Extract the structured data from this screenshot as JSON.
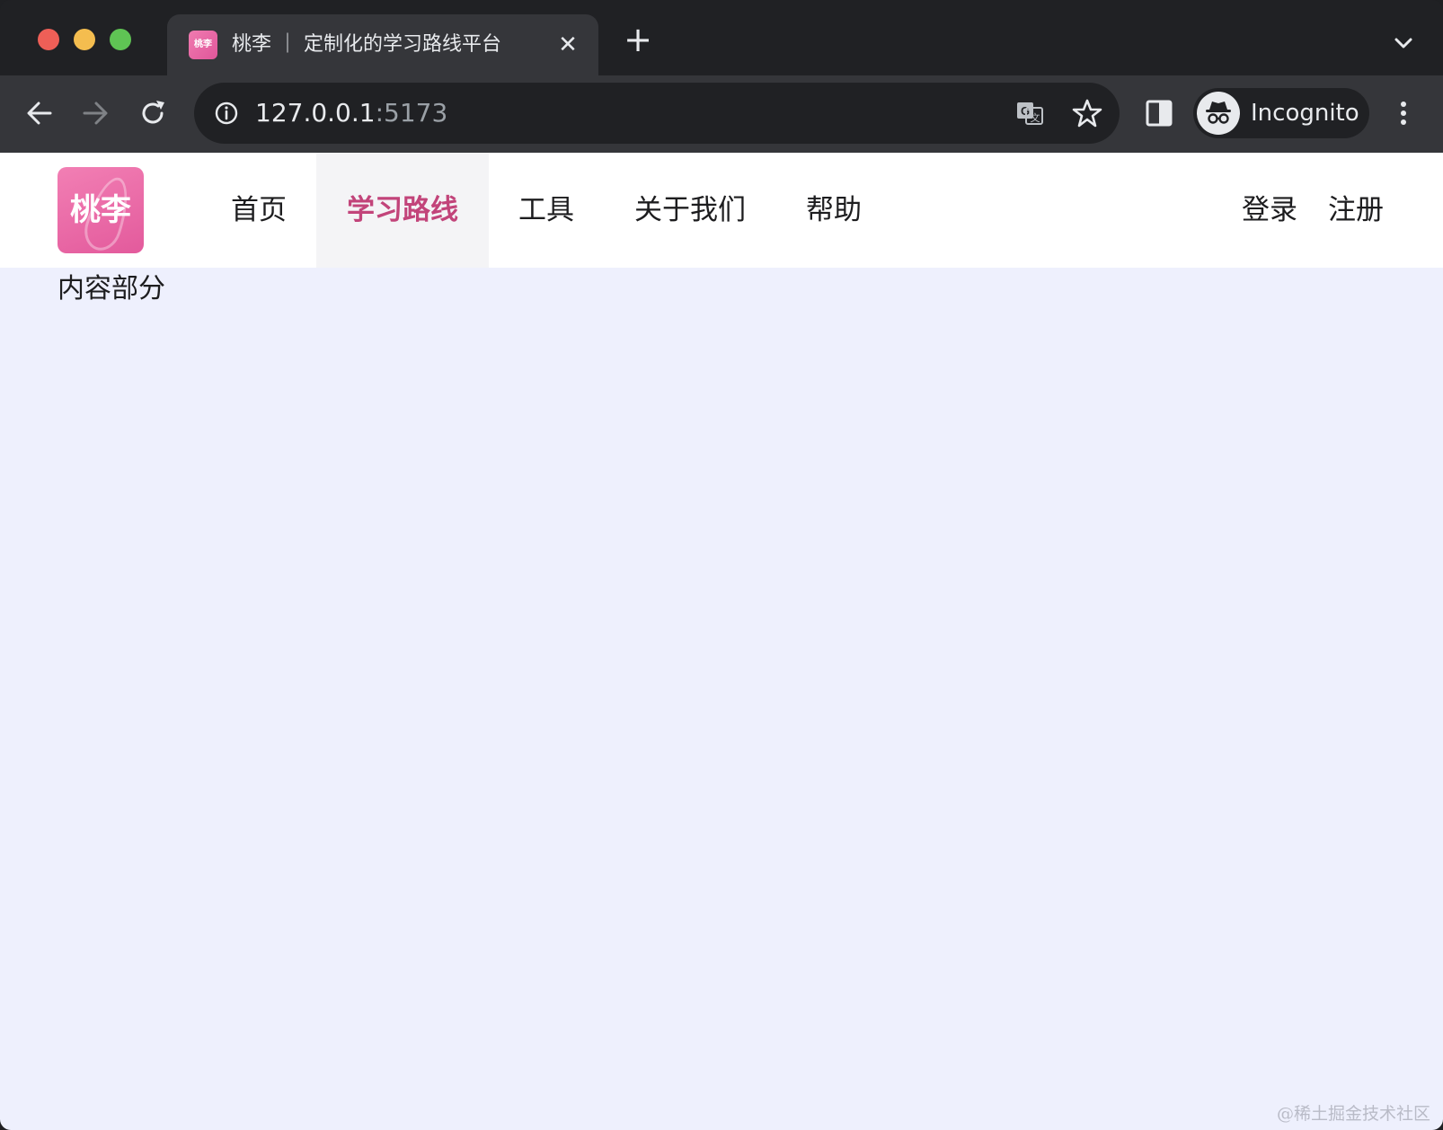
{
  "browser": {
    "tab": {
      "favicon_text": "桃李",
      "title": "桃李 ｜ 定制化的学习路线平台",
      "close_label": "✕"
    },
    "new_tab_label": "+",
    "address": {
      "host": "127.0.0.1",
      "port": ":5173"
    },
    "profile": {
      "label": "Incognito"
    },
    "icons": [
      "back-icon",
      "forward-icon",
      "reload-icon",
      "info-icon",
      "translate-icon",
      "star-icon",
      "side-panel-icon",
      "incognito-icon",
      "more-menu-icon",
      "tab-search-icon"
    ]
  },
  "site": {
    "logo_text": "桃李",
    "nav": [
      {
        "label": "首页",
        "active": false
      },
      {
        "label": "学习路线",
        "active": true
      },
      {
        "label": "工具",
        "active": false
      },
      {
        "label": "关于我们",
        "active": false
      },
      {
        "label": "帮助",
        "active": false
      }
    ],
    "auth": {
      "login": "登录",
      "register": "注册"
    },
    "content": "内容部分",
    "accent_color": "#c2447a",
    "page_background": "#eef0fd"
  },
  "watermark": "@稀土掘金技术社区"
}
